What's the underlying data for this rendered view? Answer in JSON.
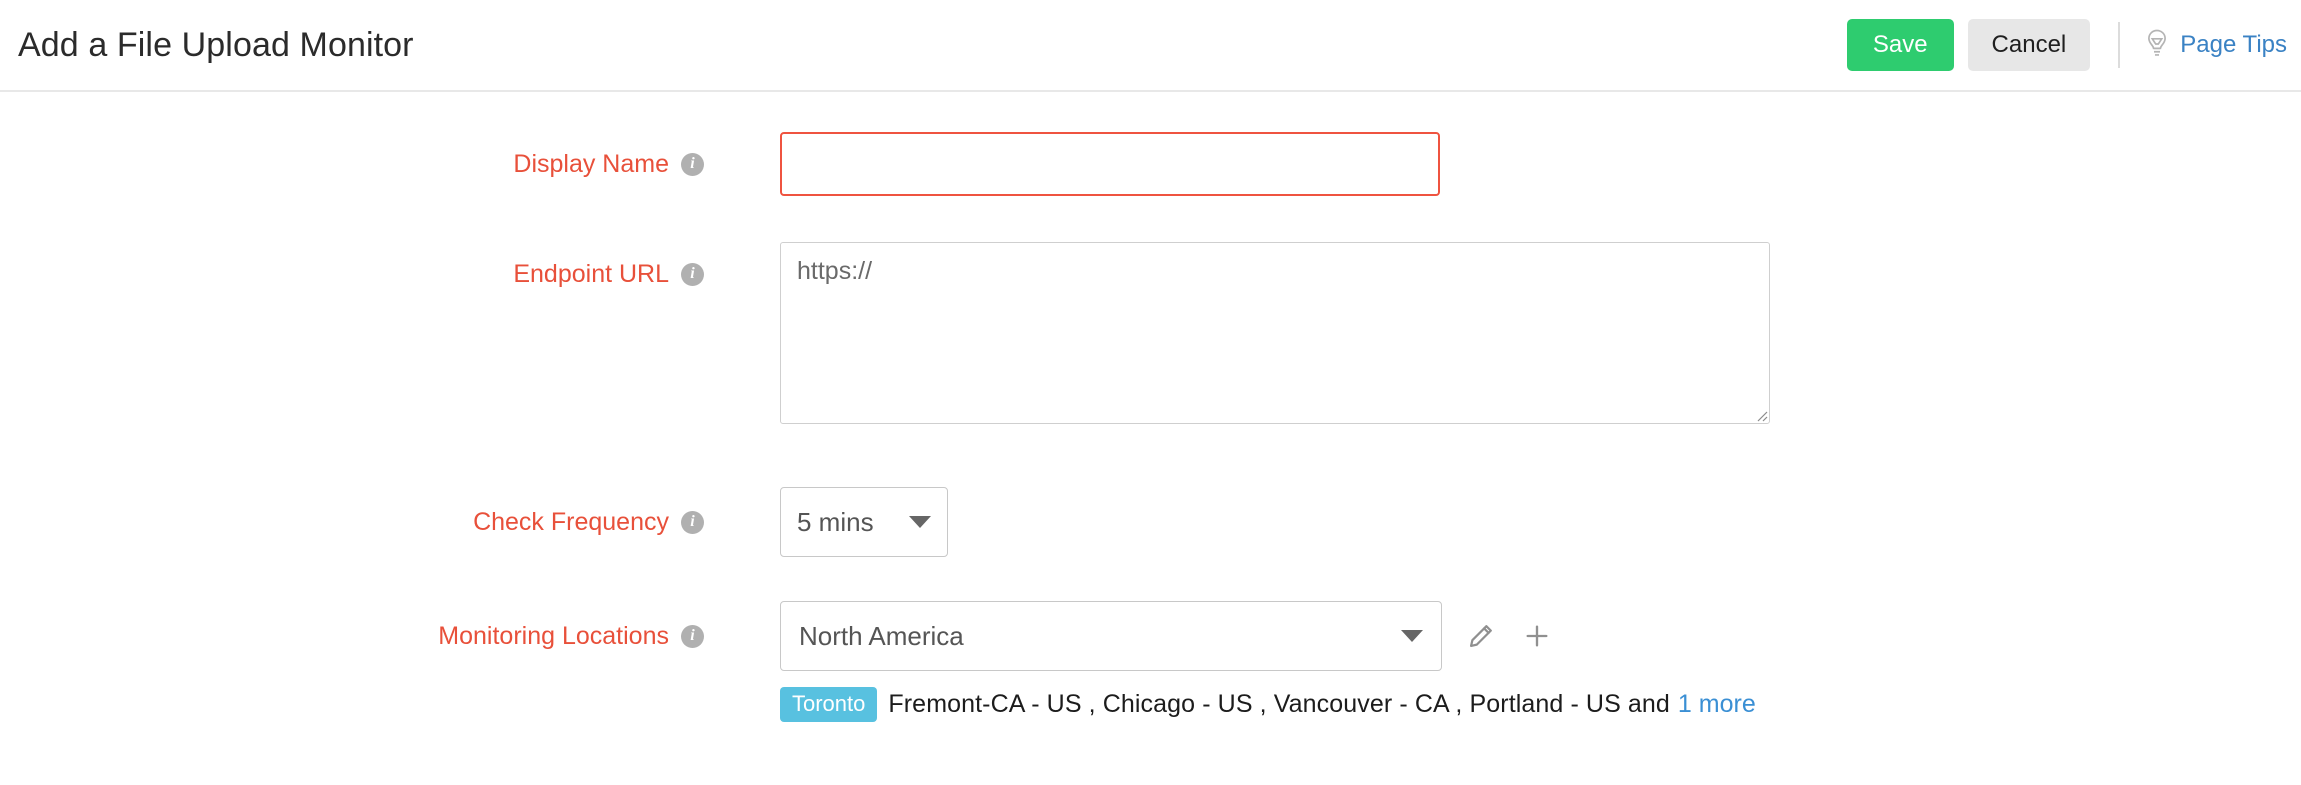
{
  "header": {
    "title": "Add a File Upload Monitor",
    "save_label": "Save",
    "cancel_label": "Cancel",
    "page_tips_label": "Page Tips",
    "bulb_icon": "lightbulb-icon",
    "save_color": "#2ecc6f",
    "cancel_color": "#e7e7e7",
    "link_color": "#3a82c4"
  },
  "form": {
    "label_color": "#e8503a",
    "info_glyph": "i",
    "display_name": {
      "label": "Display Name",
      "value": "",
      "placeholder": "",
      "border_color": "#ef5340"
    },
    "endpoint_url": {
      "label": "Endpoint URL",
      "value": "https://",
      "placeholder": "https://"
    },
    "check_frequency": {
      "label": "Check Frequency",
      "selected": "5 mins"
    },
    "monitoring_locations": {
      "label": "Monitoring Locations",
      "selected": "North America",
      "edit_icon": "pencil-icon",
      "add_icon": "plus-icon",
      "badge": "Toronto",
      "badge_color": "#58c1e0",
      "locations_text": "Fremont-CA - US , Chicago - US , Vancouver - CA , Portland - US and",
      "more_label": "1 more"
    }
  }
}
